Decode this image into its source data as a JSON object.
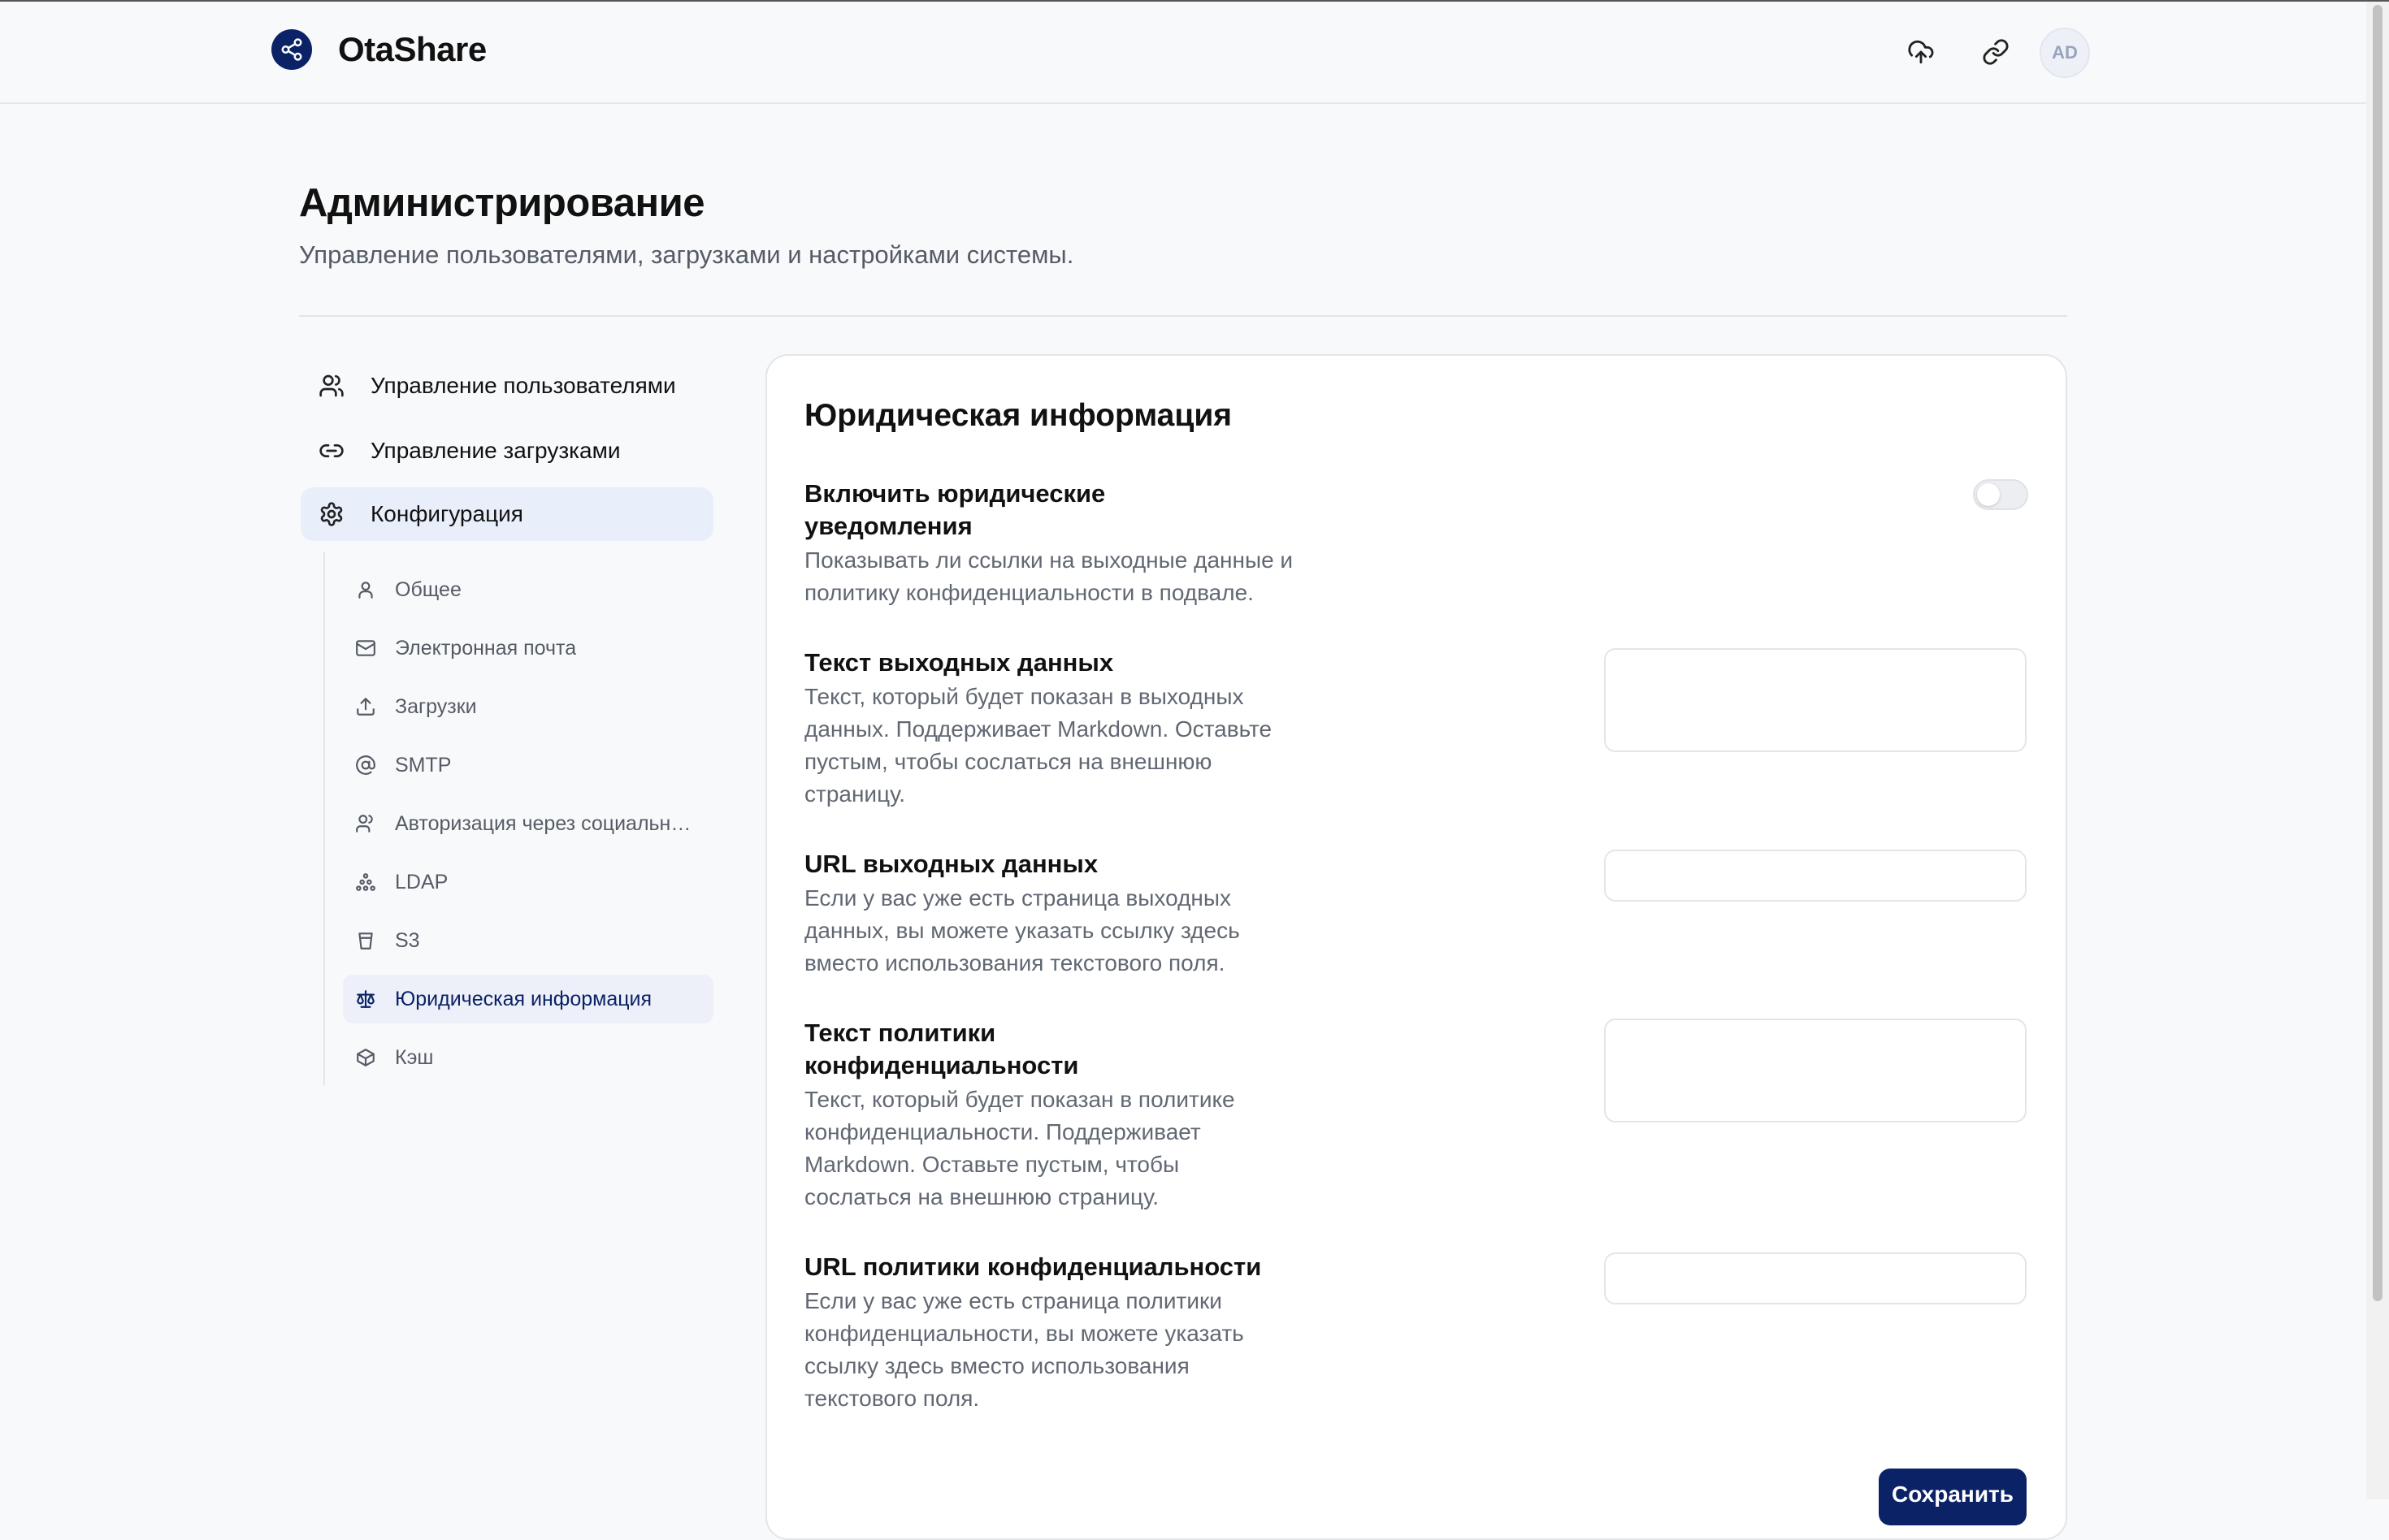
{
  "header": {
    "brand_name": "OtaShare",
    "upload_icon": "cloud-upload-icon",
    "share_icon": "link-icon",
    "avatar_initials": "AD"
  },
  "page": {
    "title": "Администрирование",
    "subtitle": "Управление пользователями, загрузками и настройками системы."
  },
  "sidebar": {
    "items": [
      {
        "label": "Управление пользователями",
        "icon": "users-icon"
      },
      {
        "label": "Управление загрузками",
        "icon": "link-icon"
      },
      {
        "label": "Конфигурация",
        "icon": "gear-icon",
        "active": true
      }
    ],
    "subitems": [
      {
        "label": "Общее",
        "icon": "user-icon"
      },
      {
        "label": "Электронная почта",
        "icon": "mail-icon"
      },
      {
        "label": "Загрузки",
        "icon": "upload-icon"
      },
      {
        "label": "SMTP",
        "icon": "at-icon"
      },
      {
        "label": "Авторизация через социальные сети",
        "icon": "users-icon"
      },
      {
        "label": "LDAP",
        "icon": "network-icon"
      },
      {
        "label": "S3",
        "icon": "bucket-icon"
      },
      {
        "label": "Юридическая информация",
        "icon": "scale-icon",
        "active": true
      },
      {
        "label": "Кэш",
        "icon": "box-icon"
      }
    ]
  },
  "legal": {
    "title": "Юридическая информация",
    "enable": {
      "label": "Включить юридические уведомления",
      "description": "Показывать ли ссылки на выходные данные и политику конфиденциальности в подвале.",
      "value": false
    },
    "imprint_text": {
      "label": "Текст выходных данных",
      "description": "Текст, который будет показан в выходных данных. Поддерживает Markdown. Оставьте пустым, чтобы сослаться на внешнюю страницу.",
      "value": ""
    },
    "imprint_url": {
      "label": "URL выходных данных",
      "description": "Если у вас уже есть страница выходных данных, вы можете указать ссылку здесь вместо использования текстового поля.",
      "value": ""
    },
    "privacy_text": {
      "label": "Текст политики конфиденциальности",
      "description": "Текст, который будет показан в политике конфиденциальности. Поддерживает Markdown. Оставьте пустым, чтобы сослаться на внешнюю страницу.",
      "value": ""
    },
    "privacy_url": {
      "label": "URL политики конфиденциальности",
      "description": "Если у вас уже есть страница политики конфиденциальности, вы можете указать ссылку здесь вместо использования текстового поля.",
      "value": ""
    },
    "save_label": "Сохранить"
  },
  "colors": {
    "primary": "#0b2266",
    "active_bg": "#e9eefb",
    "background": "#f8f9fa"
  }
}
